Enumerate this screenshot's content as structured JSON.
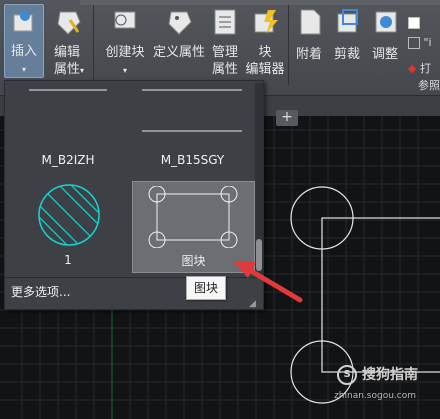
{
  "ribbon": {
    "insert_label": "插入",
    "edit_attributes_label": "编辑\n属性",
    "create_block_label": "创建块",
    "define_attributes_label": "定义属性",
    "manage_attributes_label": "管理\n属性",
    "block_editor_label": "块\n编辑器",
    "attach_label": "附着",
    "clip_label": "剪裁",
    "adjust_label": "调整",
    "reference_group_label": "参照",
    "partial_a": "\"i",
    "partial_b": "打"
  },
  "gallery": {
    "tiles": [
      {
        "label": "M_B2IZH"
      },
      {
        "label": "M_B15SGY"
      },
      {
        "label": "1"
      },
      {
        "label": "图块"
      }
    ],
    "more_options_label": "更多选项...",
    "resize_grip": "◢"
  },
  "tabs": {
    "plus_label": "+"
  },
  "tooltip": {
    "text": "图块"
  },
  "watermark": {
    "text": "搜狗指南",
    "url": "zhinan.sogou.com"
  },
  "colors": {
    "cyan": "#18d4d4",
    "arrow": "#e23a3a",
    "grid": "#2a2e31",
    "drawing": "#e6e6e6"
  }
}
